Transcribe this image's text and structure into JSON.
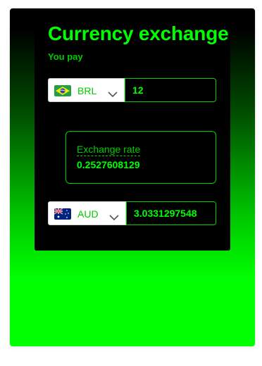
{
  "app": {
    "title": "Currency exchange",
    "pay_label": "You pay"
  },
  "from": {
    "currency": "BRL",
    "flag_icon": "brazil-flag-icon",
    "amount": "12"
  },
  "rate": {
    "label": "Exchange rate",
    "value": "0.2527608129"
  },
  "to": {
    "currency": "AUD",
    "flag_icon": "australia-flag-icon",
    "amount": "3.0331297548"
  },
  "colors": {
    "accent": "#00ff00",
    "accent_dim": "#00cc00",
    "card_bg": "#000000"
  }
}
